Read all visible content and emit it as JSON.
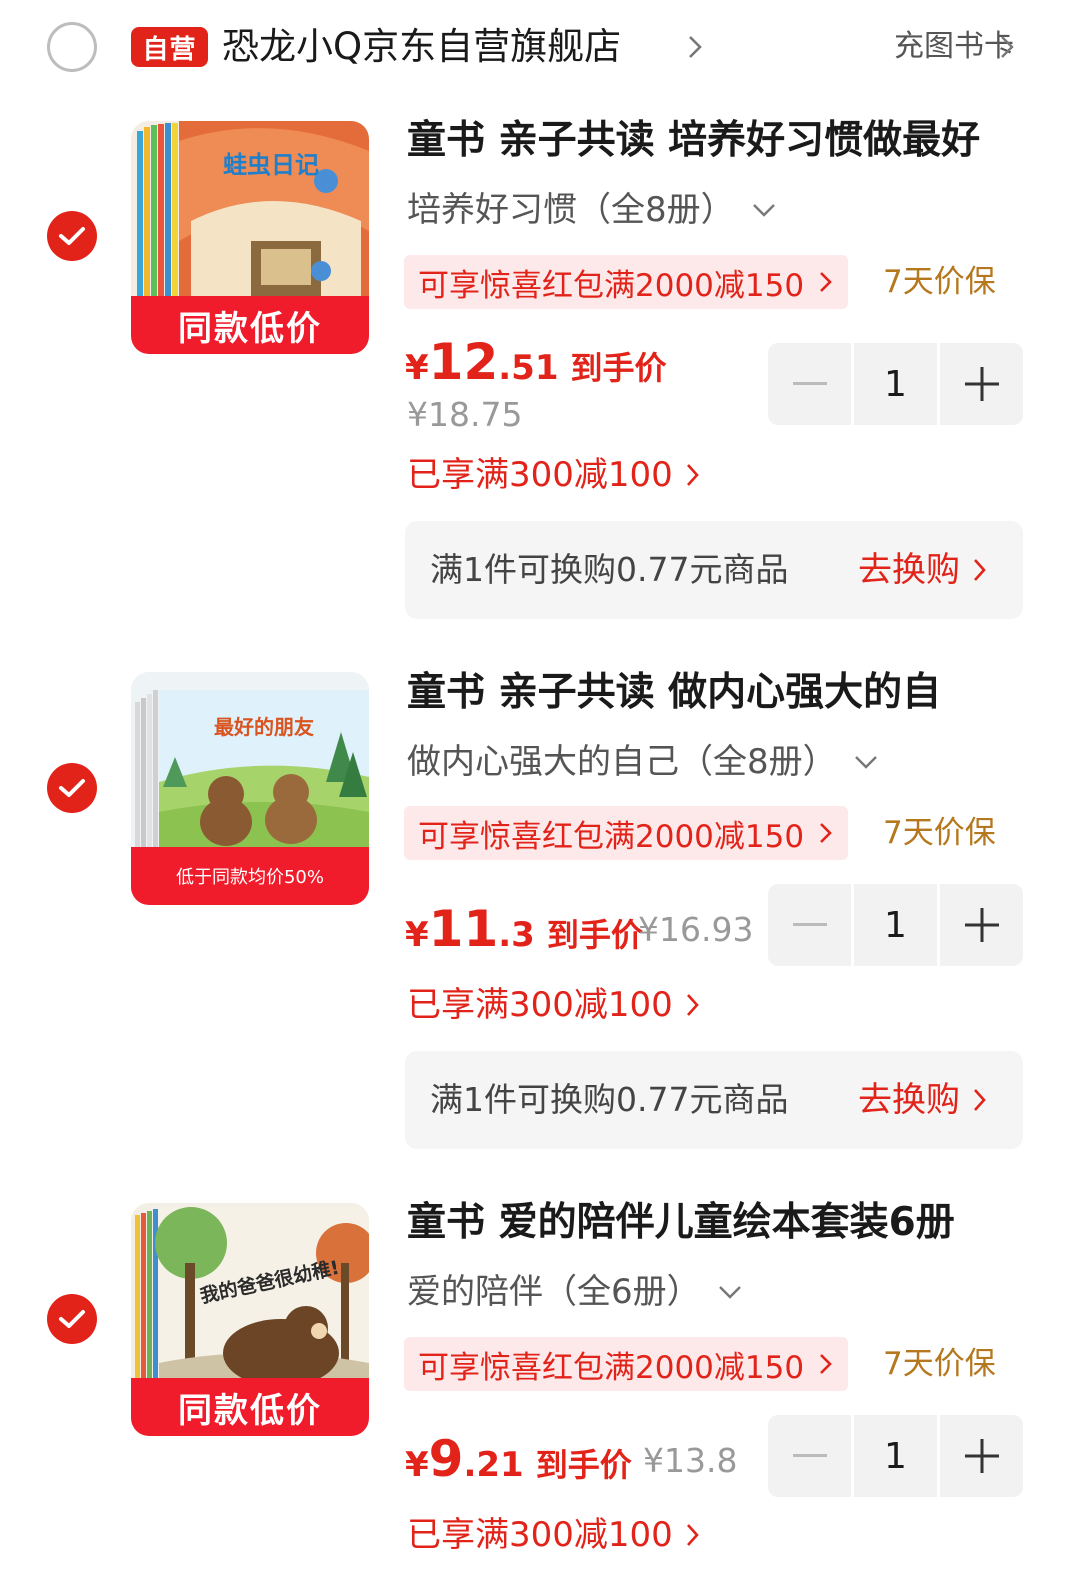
{
  "store": {
    "badge": "自营",
    "name": "恐龙小Q京东自营旗舰店",
    "card_link": "充图书卡"
  },
  "colors": {
    "brand_red": "#e2231a",
    "promo_bg": "#fde9e9",
    "guarantee": "#b5781e",
    "muted": "#999999"
  },
  "items": [
    {
      "checked": true,
      "cover_title": "蛙虫日记",
      "thumb_tag": "同款低价",
      "title": "童书 亲子共读 培养好习惯做最好",
      "variant": "培养好习惯（全8册）",
      "promo": "可享惊喜红包满2000减150",
      "guarantee": "7天价保",
      "price_yen": "¥",
      "price_int": "12",
      "price_dec": ".51",
      "price_label": "到手价",
      "original_price": "¥18.75",
      "quantity": "1",
      "discount": "已享满300减100",
      "exchange_text": "满1件可换购0.77元商品",
      "exchange_action": "去换购"
    },
    {
      "checked": true,
      "cover_title": "最好的朋友",
      "thumb_tag": "低于同款均价50%",
      "title": "童书 亲子共读  做内心强大的自",
      "variant": "做内心强大的自己（全8册）",
      "promo": "可享惊喜红包满2000减150",
      "guarantee": "7天价保",
      "price_yen": "¥",
      "price_int": "11",
      "price_dec": ".3",
      "price_label": "到手价",
      "original_price": "¥16.93",
      "quantity": "1",
      "discount": "已享满300减100",
      "exchange_text": "满1件可换购0.77元商品",
      "exchange_action": "去换购"
    },
    {
      "checked": true,
      "cover_title": "我的爸爸很幼稚!",
      "thumb_tag": "同款低价",
      "title": "童书 爱的陪伴儿童绘本套装6册",
      "variant": "爱的陪伴（全6册）",
      "promo": "可享惊喜红包满2000减150",
      "guarantee": "7天价保",
      "price_yen": "¥",
      "price_int": "9",
      "price_dec": ".21",
      "price_label": "到手价",
      "original_price": "¥13.8",
      "quantity": "1",
      "discount": "已享满300减100"
    }
  ]
}
